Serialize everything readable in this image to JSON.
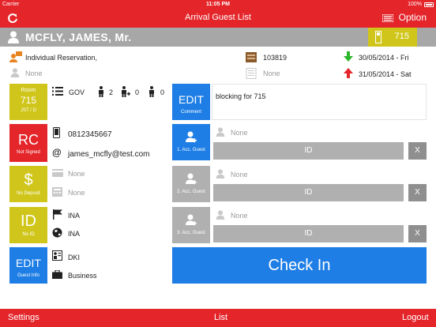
{
  "status": {
    "carrier": "Carrier",
    "time": "11:05 PM",
    "battery": "100%"
  },
  "nav": {
    "title": "Arrival Guest List",
    "option": "Option"
  },
  "guest": {
    "name": "MCFLY,  JAMES, Mr.",
    "room": "715"
  },
  "reservation": {
    "type": "Individual Reservation,",
    "contact": "None",
    "number": "103819",
    "number2": "None",
    "arrival": "30/05/2014 - Fri",
    "departure": "31/05/2014 - Sat"
  },
  "room_tile": {
    "title": "Room",
    "number": "715",
    "sub": "JST / D"
  },
  "room_info": {
    "rate": "GOV",
    "adults": "2",
    "children": "0",
    "infants": "0"
  },
  "comment": {
    "title": "EDIT",
    "sub": "Comment",
    "text": "blocking for 715"
  },
  "rc_tile": {
    "title": "RC",
    "sub": "Not Signed"
  },
  "contact": {
    "phone": "0812345667",
    "email": "james_mcfly@test.com"
  },
  "deposit_tile": {
    "title": "$",
    "sub": "No Deposit"
  },
  "deposit": {
    "line1": "None",
    "line2": "None"
  },
  "id_tile": {
    "title": "ID",
    "sub": "No ID"
  },
  "id_info": {
    "nationality": "INA",
    "country": "INA"
  },
  "guest_info_tile": {
    "title": "EDIT",
    "sub": "Guest Info"
  },
  "guest_info": {
    "segment": "DKI",
    "purpose": "Business"
  },
  "acc_guests": [
    {
      "label": "1. Acc. Guest",
      "name": "None",
      "id": "ID",
      "x": "X"
    },
    {
      "label": "2. Acc. Guest",
      "name": "None",
      "id": "ID",
      "x": "X"
    },
    {
      "label": "3. Acc. Guest",
      "name": "None",
      "id": "ID",
      "x": "X"
    }
  ],
  "checkin": "Check In",
  "tabs": {
    "settings": "Settings",
    "list": "List",
    "logout": "Logout"
  },
  "colors": {
    "red": "#e4262b",
    "yellow": "#d0c61b",
    "blue": "#1e7ee5",
    "gray": "#a7a7a7"
  }
}
